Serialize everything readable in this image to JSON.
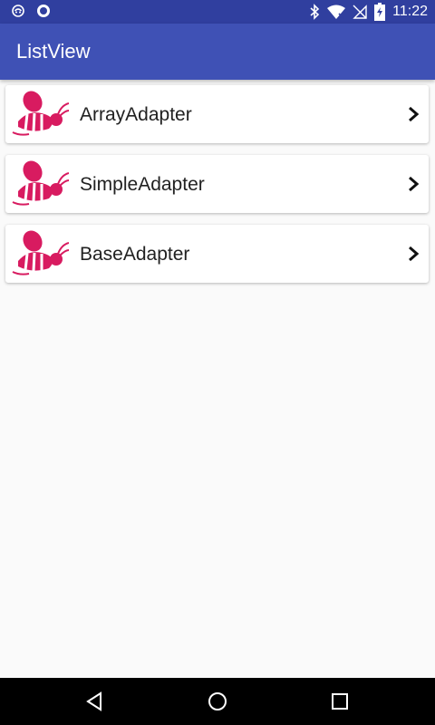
{
  "status_bar": {
    "time": "11:22",
    "left_icons": [
      "notification-icon",
      "circle-notification-icon"
    ],
    "right_icons": [
      "bluetooth-icon",
      "wifi-icon",
      "no-sim-icon",
      "battery-charging-icon"
    ]
  },
  "app_bar": {
    "title": "ListView"
  },
  "list": {
    "items": [
      {
        "label": "ArrayAdapter",
        "icon": "bee-icon"
      },
      {
        "label": "SimpleAdapter",
        "icon": "bee-icon"
      },
      {
        "label": "BaseAdapter",
        "icon": "bee-icon"
      }
    ]
  },
  "nav_bar": {
    "buttons": [
      "back-icon",
      "home-icon",
      "recents-icon"
    ]
  },
  "colors": {
    "status_bar": "#303f9f",
    "app_bar": "#3f51b5",
    "background": "#fafafa",
    "bee": "#d81b60"
  }
}
